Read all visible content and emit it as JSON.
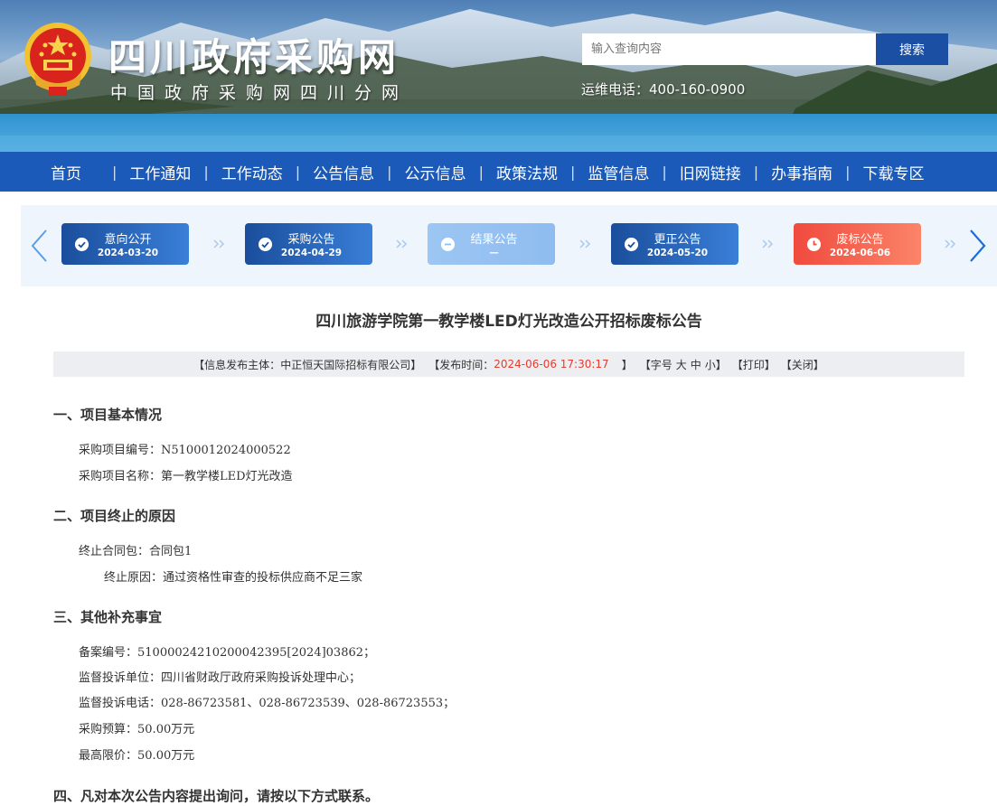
{
  "header": {
    "site_title": "四川政府采购网",
    "site_subtitle": "中国政府采购网四川分网",
    "search_placeholder": "输入查询内容",
    "search_button": "搜索",
    "hotline": "运维电话：400-160-0900",
    "emblem_icon": "national-emblem-icon"
  },
  "nav": {
    "items": [
      "首页",
      "工作通知",
      "工作动态",
      "公告信息",
      "公示信息",
      "政策法规",
      "监管信息",
      "旧网链接",
      "办事指南",
      "下载专区"
    ],
    "separator": "|"
  },
  "progress": {
    "steps": [
      {
        "label": "意向公开",
        "date": "2024-03-20",
        "state": "done",
        "color": "#1a4e9c",
        "icon": "check-circle-icon"
      },
      {
        "label": "采购公告",
        "date": "2024-04-29",
        "state": "done",
        "color": "#1a4e9c",
        "icon": "check-circle-icon"
      },
      {
        "label": "结果公告",
        "date": "—",
        "state": "skipped",
        "color": "#9cc6f3",
        "icon": "minus-circle-icon"
      },
      {
        "label": "更正公告",
        "date": "2024-05-20",
        "state": "done",
        "color": "#1a4e9c",
        "icon": "check-circle-icon"
      },
      {
        "label": "废标公告",
        "date": "2024-06-06",
        "state": "current",
        "color": "#f04a3e",
        "icon": "clock-icon"
      }
    ]
  },
  "article": {
    "title": "四川旅游学院第一教学楼LED灯光改造公开招标废标公告",
    "meta": {
      "publisher_prefix": "【信息发布主体：",
      "publisher": "中正恒天国际招标有限公司",
      "publisher_suffix": "】",
      "time_prefix": "【发布时间：",
      "time": "2024-06-06 17:30:17",
      "time_suffix": "】",
      "font_prefix": "【字号",
      "font_large": "大",
      "font_medium": "中",
      "font_small": "小",
      "font_suffix": "】",
      "print": "【打印】",
      "close": "【关闭】"
    },
    "sections": {
      "s1": {
        "heading": "一、项目基本情况",
        "project_no_label": "采购项目编号：",
        "project_no": "N5100012024000522",
        "project_name_label": "采购项目名称：",
        "project_name": "第一教学楼LED灯光改造"
      },
      "s2": {
        "heading": "二、项目终止的原因",
        "package_label": "终止合同包：",
        "package": "合同包1",
        "reason_label": "终止原因：",
        "reason": "通过资格性审查的投标供应商不足三家"
      },
      "s3": {
        "heading": "三、其他补充事宜",
        "record_label": "备案编号：",
        "record": "51000024210200042395[2024]03862；",
        "complaint_unit_label": "监督投诉单位：",
        "complaint_unit": "四川省财政厅政府采购投诉处理中心；",
        "complaint_phone_label": "监督投诉电话：",
        "complaint_phone": "028-86723581、028-86723539、028-86723553；",
        "budget_label": "采购预算：",
        "budget": "50.00万元",
        "max_price_label": "最高限价：",
        "max_price": "50.00万元"
      },
      "s4": {
        "heading": "四、凡对本次公告内容提出询问，请按以下方式联系。"
      }
    }
  }
}
